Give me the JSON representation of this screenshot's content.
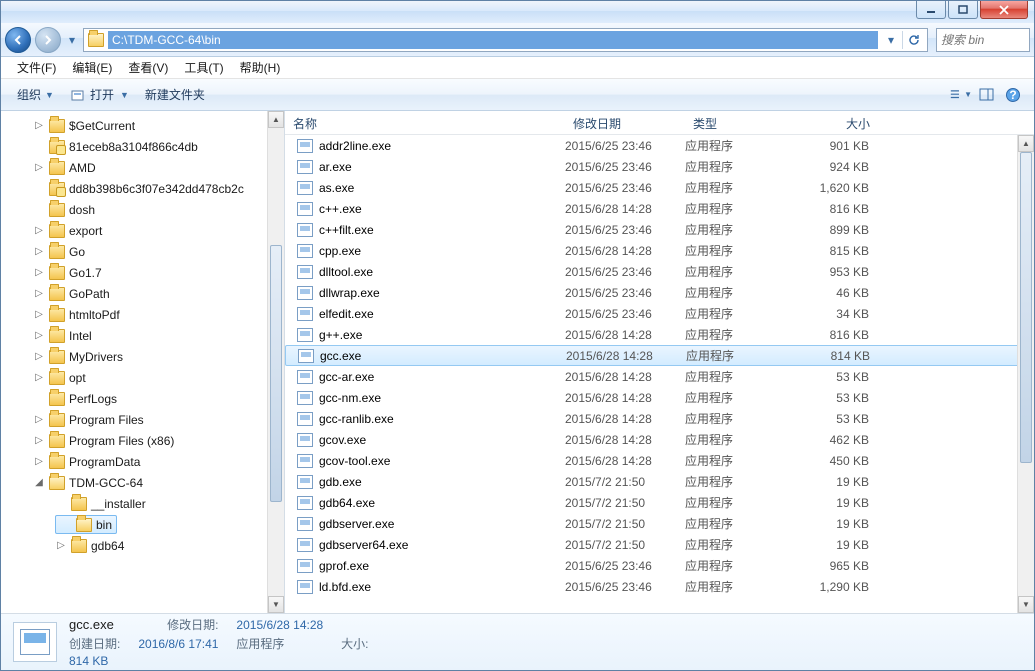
{
  "address_path": "C:\\TDM-GCC-64\\bin",
  "search_placeholder": "搜索 bin",
  "menu": {
    "file": "文件(F)",
    "edit": "编辑(E)",
    "view": "查看(V)",
    "tools": "工具(T)",
    "help": "帮助(H)"
  },
  "toolbar": {
    "organize": "组织",
    "open": "打开",
    "newfolder": "新建文件夹"
  },
  "columns": {
    "name": "名称",
    "date": "修改日期",
    "type": "类型",
    "size": "大小"
  },
  "tree": [
    {
      "label": "$GetCurrent",
      "lvl": 1,
      "arrow": "▷"
    },
    {
      "label": "81eceb8a3104f866c4db",
      "lvl": 1,
      "arrow": "",
      "locked": true
    },
    {
      "label": "AMD",
      "lvl": 1,
      "arrow": "▷"
    },
    {
      "label": "dd8b398b6c3f07e342dd478cb2c",
      "lvl": 1,
      "arrow": "",
      "locked": true
    },
    {
      "label": "dosh",
      "lvl": 1,
      "arrow": ""
    },
    {
      "label": "export",
      "lvl": 1,
      "arrow": "▷"
    },
    {
      "label": "Go",
      "lvl": 1,
      "arrow": "▷"
    },
    {
      "label": "Go1.7",
      "lvl": 1,
      "arrow": "▷"
    },
    {
      "label": "GoPath",
      "lvl": 1,
      "arrow": "▷"
    },
    {
      "label": "htmltoPdf",
      "lvl": 1,
      "arrow": "▷"
    },
    {
      "label": "Intel",
      "lvl": 1,
      "arrow": "▷"
    },
    {
      "label": "MyDrivers",
      "lvl": 1,
      "arrow": "▷"
    },
    {
      "label": "opt",
      "lvl": 1,
      "arrow": "▷"
    },
    {
      "label": "PerfLogs",
      "lvl": 1,
      "arrow": ""
    },
    {
      "label": "Program Files",
      "lvl": 1,
      "arrow": "▷"
    },
    {
      "label": "Program Files (x86)",
      "lvl": 1,
      "arrow": "▷"
    },
    {
      "label": "ProgramData",
      "lvl": 1,
      "arrow": "▷"
    },
    {
      "label": "TDM-GCC-64",
      "lvl": 1,
      "arrow": "◢",
      "open": true
    },
    {
      "label": "__installer",
      "lvl": 2,
      "arrow": ""
    },
    {
      "label": "bin",
      "lvl": 2,
      "arrow": "",
      "sel": true,
      "open": true
    },
    {
      "label": "gdb64",
      "lvl": 2,
      "arrow": "▷"
    }
  ],
  "file_type": "应用程序",
  "files": [
    {
      "name": "addr2line.exe",
      "date": "2015/6/25 23:46",
      "size": "901 KB"
    },
    {
      "name": "ar.exe",
      "date": "2015/6/25 23:46",
      "size": "924 KB"
    },
    {
      "name": "as.exe",
      "date": "2015/6/25 23:46",
      "size": "1,620 KB"
    },
    {
      "name": "c++.exe",
      "date": "2015/6/28 14:28",
      "size": "816 KB"
    },
    {
      "name": "c++filt.exe",
      "date": "2015/6/25 23:46",
      "size": "899 KB"
    },
    {
      "name": "cpp.exe",
      "date": "2015/6/28 14:28",
      "size": "815 KB"
    },
    {
      "name": "dlltool.exe",
      "date": "2015/6/25 23:46",
      "size": "953 KB"
    },
    {
      "name": "dllwrap.exe",
      "date": "2015/6/25 23:46",
      "size": "46 KB"
    },
    {
      "name": "elfedit.exe",
      "date": "2015/6/25 23:46",
      "size": "34 KB"
    },
    {
      "name": "g++.exe",
      "date": "2015/6/28 14:28",
      "size": "816 KB"
    },
    {
      "name": "gcc.exe",
      "date": "2015/6/28 14:28",
      "size": "814 KB",
      "sel": true
    },
    {
      "name": "gcc-ar.exe",
      "date": "2015/6/28 14:28",
      "size": "53 KB"
    },
    {
      "name": "gcc-nm.exe",
      "date": "2015/6/28 14:28",
      "size": "53 KB"
    },
    {
      "name": "gcc-ranlib.exe",
      "date": "2015/6/28 14:28",
      "size": "53 KB"
    },
    {
      "name": "gcov.exe",
      "date": "2015/6/28 14:28",
      "size": "462 KB"
    },
    {
      "name": "gcov-tool.exe",
      "date": "2015/6/28 14:28",
      "size": "450 KB"
    },
    {
      "name": "gdb.exe",
      "date": "2015/7/2 21:50",
      "size": "19 KB"
    },
    {
      "name": "gdb64.exe",
      "date": "2015/7/2 21:50",
      "size": "19 KB"
    },
    {
      "name": "gdbserver.exe",
      "date": "2015/7/2 21:50",
      "size": "19 KB"
    },
    {
      "name": "gdbserver64.exe",
      "date": "2015/7/2 21:50",
      "size": "19 KB"
    },
    {
      "name": "gprof.exe",
      "date": "2015/6/25 23:46",
      "size": "965 KB"
    },
    {
      "name": "ld.bfd.exe",
      "date": "2015/6/25 23:46",
      "size": "1,290 KB"
    }
  ],
  "details": {
    "filename": "gcc.exe",
    "filetype": "应用程序",
    "mod_label": "修改日期:",
    "mod_value": "2015/6/28 14:28",
    "size_label": "大小:",
    "size_value": "814 KB",
    "created_label": "创建日期:",
    "created_value": "2016/8/6 17:41"
  }
}
